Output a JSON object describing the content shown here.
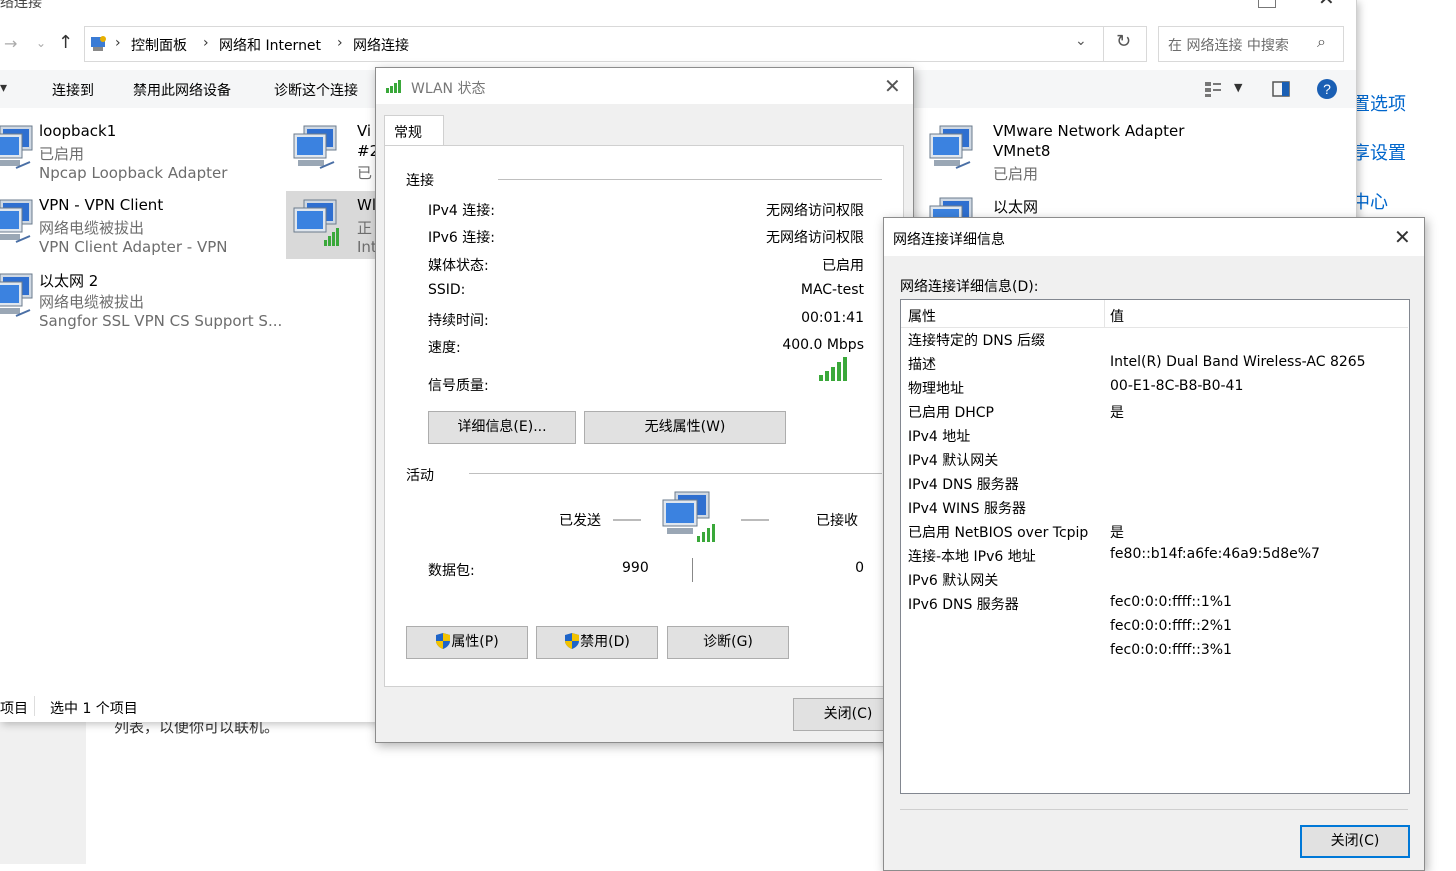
{
  "background_links": [
    "置选项",
    "享设置",
    "中心"
  ],
  "background_text": "列表，以便你可以联机。",
  "explorer": {
    "title": "络连接",
    "breadcrumb": [
      "控制面板",
      "网络和 Internet",
      "网络连接"
    ],
    "search_placeholder": "在 网络连接 中搜索",
    "toolbar": {
      "organize_partial": "▾",
      "connect_to": "连接到",
      "disable_device": "禁用此网络设备",
      "diagnose": "诊断这个连接"
    },
    "items": [
      {
        "name": "loopback1",
        "status": "已启用",
        "adapter": "Npcap Loopback Adapter"
      },
      {
        "name": "VPN - VPN Client",
        "status": "网络电缆被拔出",
        "adapter": "VPN Client Adapter - VPN"
      },
      {
        "name": "以太网 2",
        "status": "网络电缆被拔出",
        "adapter": "Sangfor SSL VPN CS Support S..."
      },
      {
        "name": "Vi",
        "status": "#2",
        "adapter": "已"
      },
      {
        "name": "Wl",
        "status": "正",
        "adapter": "Int"
      },
      {
        "name": "VMware Network Adapter",
        "status": "VMnet8",
        "adapter": "已启用"
      },
      {
        "name": "以太网",
        "status": "",
        "adapter": ""
      }
    ],
    "statusbar": {
      "items": "项目",
      "selected": "选中 1 个项目"
    }
  },
  "wlan_dialog": {
    "title": "WLAN 状态",
    "tab": "常规",
    "connection_section": "连接",
    "rows": [
      {
        "label": "IPv4 连接:",
        "value": "无网络访问权限"
      },
      {
        "label": "IPv6 连接:",
        "value": "无网络访问权限"
      },
      {
        "label": "媒体状态:",
        "value": "已启用"
      },
      {
        "label": "SSID:",
        "value": "MAC-test"
      },
      {
        "label": "持续时间:",
        "value": "00:01:41"
      },
      {
        "label": "速度:",
        "value": "400.0 Mbps"
      }
    ],
    "signal_label": "信号质量:",
    "details_button": "详细信息(E)...",
    "wireless_props_button": "无线属性(W)",
    "activity_section": "活动",
    "sent_label": "已发送",
    "received_label": "已接收",
    "packets_label": "数据包:",
    "packets_sent": "990",
    "packets_received": "0",
    "properties_button": "属性(P)",
    "disable_button": "禁用(D)",
    "diagnose_button": "诊断(G)",
    "close_button": "关闭(C)"
  },
  "details_dialog": {
    "title": "网络连接详细信息",
    "label": "网络连接详细信息(D):",
    "col_property": "属性",
    "col_value": "值",
    "rows": [
      {
        "property": "连接特定的 DNS 后缀",
        "value": ""
      },
      {
        "property": "描述",
        "value": "Intel(R) Dual Band Wireless-AC 8265"
      },
      {
        "property": "物理地址",
        "value": "00-E1-8C-B8-B0-41"
      },
      {
        "property": "已启用 DHCP",
        "value": "是"
      },
      {
        "property": "IPv4 地址",
        "value": ""
      },
      {
        "property": "IPv4 默认网关",
        "value": ""
      },
      {
        "property": "IPv4 DNS 服务器",
        "value": ""
      },
      {
        "property": "IPv4 WINS 服务器",
        "value": ""
      },
      {
        "property": "已启用 NetBIOS over Tcpip",
        "value": "是"
      },
      {
        "property": "连接-本地 IPv6 地址",
        "value": "fe80::b14f:a6fe:46a9:5d8e%7"
      },
      {
        "property": "IPv6 默认网关",
        "value": ""
      },
      {
        "property": "IPv6 DNS 服务器",
        "value": "fec0:0:0:ffff::1%1"
      },
      {
        "property": "",
        "value": "fec0:0:0:ffff::2%1"
      },
      {
        "property": "",
        "value": "fec0:0:0:ffff::3%1"
      }
    ],
    "close_button": "关闭(C)"
  },
  "colors": {
    "accent": "#0078d7",
    "link": "#0066cc",
    "signal": "#3aa83a"
  }
}
